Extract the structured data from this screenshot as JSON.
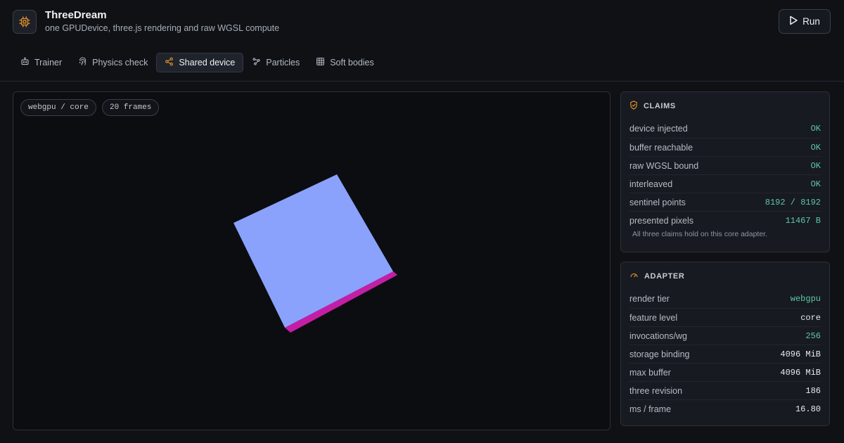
{
  "app": {
    "title": "ThreeDream",
    "subtitle": "one GPUDevice, three.js rendering and raw WGSL compute",
    "icon": "cpu-chip-icon",
    "accent": "#e0922f"
  },
  "toolbar": {
    "run_label": "Run"
  },
  "tabs": [
    {
      "label": "Trainer",
      "icon": "robot-icon",
      "active": false
    },
    {
      "label": "Physics check",
      "icon": "fingerprint-icon",
      "active": false
    },
    {
      "label": "Shared device",
      "icon": "share-nodes-icon",
      "active": true
    },
    {
      "label": "Particles",
      "icon": "waypoints-icon",
      "active": false
    },
    {
      "label": "Soft bodies",
      "icon": "grid-icon",
      "active": false
    }
  ],
  "viewport": {
    "chips": [
      "webgpu / core",
      "20 frames"
    ],
    "cube_colors": {
      "face": "#8aa2fb",
      "edge": "#c51ea6"
    }
  },
  "claims": {
    "title": "CLAIMS",
    "icon": "shield-check-icon",
    "rows": [
      {
        "key": "device injected",
        "value": "OK",
        "status": "ok"
      },
      {
        "key": "buffer reachable",
        "value": "OK",
        "status": "ok"
      },
      {
        "key": "raw WGSL bound",
        "value": "OK",
        "status": "ok"
      },
      {
        "key": "interleaved",
        "value": "OK",
        "status": "ok"
      },
      {
        "key": "sentinel points",
        "value": "8192 / 8192",
        "status": "ok"
      },
      {
        "key": "presented pixels",
        "value": "11467 B",
        "status": "ok"
      }
    ],
    "note": "All three claims hold on this core adapter."
  },
  "adapter": {
    "title": "ADAPTER",
    "icon": "gauge-icon",
    "rows": [
      {
        "key": "render tier",
        "value": "webgpu",
        "status": "ok"
      },
      {
        "key": "feature level",
        "value": "core",
        "status": "plain"
      },
      {
        "key": "invocations/wg",
        "value": "256",
        "status": "ok"
      },
      {
        "key": "storage binding",
        "value": "4096 MiB",
        "status": "plain"
      },
      {
        "key": "max buffer",
        "value": "4096 MiB",
        "status": "plain"
      },
      {
        "key": "three revision",
        "value": "186",
        "status": "plain"
      },
      {
        "key": "ms / frame",
        "value": "16.80",
        "status": "plain"
      }
    ]
  }
}
